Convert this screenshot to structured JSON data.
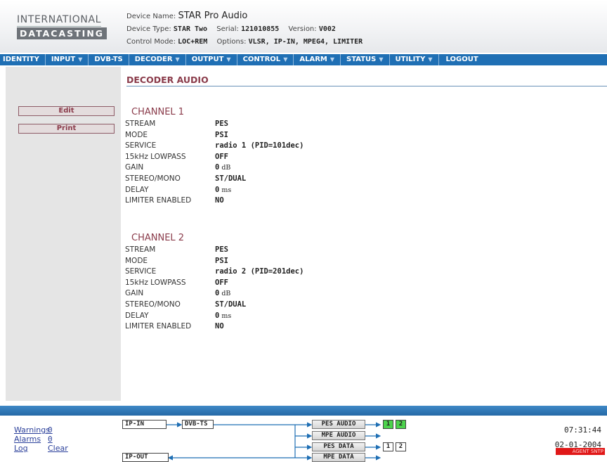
{
  "logo": {
    "top": "INTERNATIONAL",
    "bottom": "DATACASTING"
  },
  "device": {
    "name_label": "Device Name:",
    "name": "STAR Pro Audio",
    "type_label": "Device Type:",
    "type": "STAR Two",
    "serial_label": "Serial:",
    "serial": "121010855",
    "version_label": "Version:",
    "version": "V002",
    "control_label": "Control Mode:",
    "control": "LOC+REM",
    "options_label": "Options:",
    "options": "VLSR, IP-IN, MPEG4, LIMITER"
  },
  "menu": [
    {
      "label": "IDENTITY",
      "dropdown": false
    },
    {
      "label": "INPUT",
      "dropdown": true
    },
    {
      "label": "DVB-TS",
      "dropdown": false
    },
    {
      "label": "DECODER",
      "dropdown": true
    },
    {
      "label": "OUTPUT",
      "dropdown": true
    },
    {
      "label": "CONTROL",
      "dropdown": true
    },
    {
      "label": "ALARM",
      "dropdown": true
    },
    {
      "label": "STATUS",
      "dropdown": true
    },
    {
      "label": "UTILITY",
      "dropdown": true
    },
    {
      "label": "LOGOUT",
      "dropdown": false
    }
  ],
  "sidebar": {
    "edit": "Edit",
    "print": "Print"
  },
  "page_title": "DECODER AUDIO",
  "channels": [
    {
      "title": "CHANNEL 1",
      "rows": [
        {
          "label": "STREAM",
          "value": "PES",
          "unit": ""
        },
        {
          "label": "MODE",
          "value": "PSI",
          "unit": ""
        },
        {
          "label": "SERVICE",
          "value": "radio 1 (PID=101dec)",
          "unit": ""
        },
        {
          "label": "15kHz LOWPASS",
          "value": "OFF",
          "unit": ""
        },
        {
          "label": "GAIN",
          "value": "0",
          "unit": "dB"
        },
        {
          "label": "STEREO/MONO",
          "value": "ST/DUAL",
          "unit": ""
        },
        {
          "label": "DELAY",
          "value": "0",
          "unit": "ms"
        },
        {
          "label": "LIMITER ENABLED",
          "value": "NO",
          "unit": ""
        }
      ]
    },
    {
      "title": "CHANNEL 2",
      "rows": [
        {
          "label": "STREAM",
          "value": "PES",
          "unit": ""
        },
        {
          "label": "MODE",
          "value": "PSI",
          "unit": ""
        },
        {
          "label": "SERVICE",
          "value": "radio 2 (PID=201dec)",
          "unit": ""
        },
        {
          "label": "15kHz LOWPASS",
          "value": "OFF",
          "unit": ""
        },
        {
          "label": "GAIN",
          "value": "0",
          "unit": "dB"
        },
        {
          "label": "STEREO/MONO",
          "value": "ST/DUAL",
          "unit": ""
        },
        {
          "label": "DELAY",
          "value": "0",
          "unit": "ms"
        },
        {
          "label": "LIMITER ENABLED",
          "value": "NO",
          "unit": ""
        }
      ]
    }
  ],
  "footer": {
    "warnings_label": "Warnings",
    "warnings_count": "0",
    "alarms_label": "Alarms",
    "alarms_count": "0",
    "log_label": "Log",
    "clear_label": "Clear",
    "time": "07:31:44",
    "date": "02-01-2004",
    "alert_text": "AGENT SNTP"
  },
  "diagram": {
    "ip_in": "IP-IN",
    "dvb_ts": "DVB-TS",
    "ip_out": "IP-OUT",
    "pes_audio": "PES AUDIO",
    "mpe_audio": "MPE AUDIO",
    "pes_data": "PES DATA",
    "mpe_data": "MPE DATA",
    "audio_ch1": "1",
    "audio_ch2": "2",
    "data_ch1": "1",
    "data_ch2": "2",
    "line_color": "#1f6fb4",
    "active_color": "#4cd34c"
  }
}
